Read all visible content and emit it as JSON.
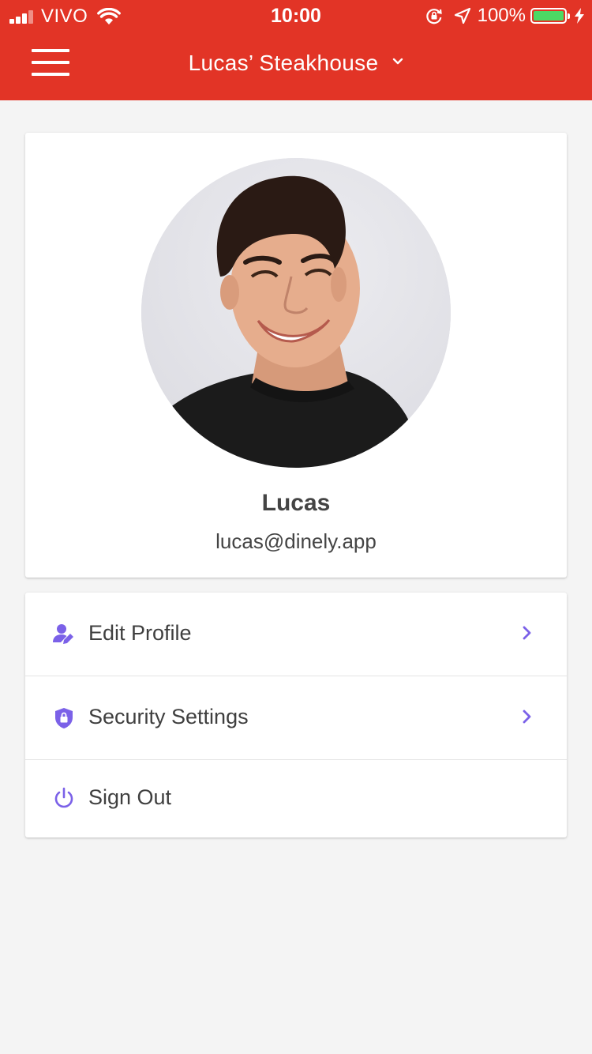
{
  "status_bar": {
    "carrier": "VIVO",
    "time": "10:00",
    "battery_percent": "100%",
    "battery_level": 1.0
  },
  "header": {
    "restaurant_name": "Lucas’ Steakhouse"
  },
  "profile": {
    "name": "Lucas",
    "email": "lucas@dinely.app"
  },
  "menu": {
    "items": [
      {
        "label": "Edit Profile",
        "icon": "edit-user-icon"
      },
      {
        "label": "Security Settings",
        "icon": "shield-lock-icon"
      },
      {
        "label": "Sign Out",
        "icon": "power-icon"
      }
    ]
  },
  "colors": {
    "header_red": "#e23426",
    "accent_purple": "#7b61e8",
    "background": "#f4f4f4"
  }
}
